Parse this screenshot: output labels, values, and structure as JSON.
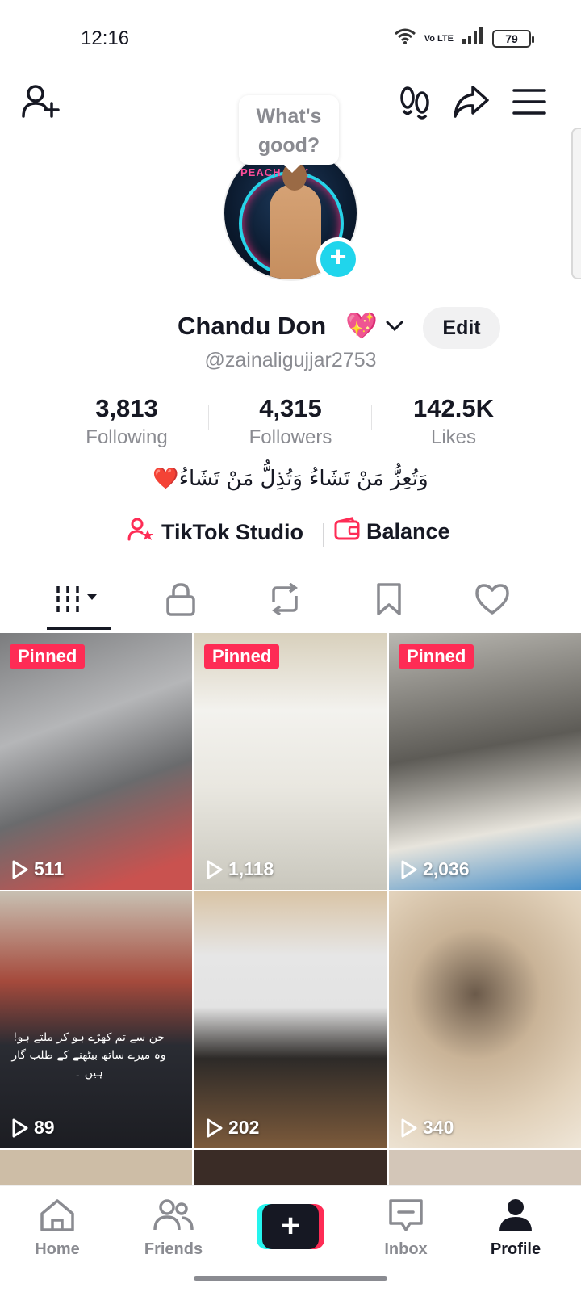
{
  "status_bar": {
    "time": "12:16",
    "network": "Vo LTE",
    "battery": "79"
  },
  "bubble": {
    "text": "What's good?"
  },
  "avatar": {
    "overlay_text": "PEACH TOK"
  },
  "profile": {
    "display_name": "Chandu Don",
    "name_emoji": "💖",
    "edit_label": "Edit",
    "username": "@zainaligujjar2753",
    "bio": "وَتُعِزُّ مَنْ تَشَاءُ وَتُذِلُّ مَنْ تَشَاءُ❤️"
  },
  "stats": [
    {
      "value": "3,813",
      "label": "Following"
    },
    {
      "value": "4,315",
      "label": "Followers"
    },
    {
      "value": "142.5K",
      "label": "Likes"
    }
  ],
  "links": {
    "studio": "TikTok Studio",
    "balance": "Balance"
  },
  "tabs": [
    "videos-tab",
    "private-tab",
    "reposts-tab",
    "favorites-tab",
    "liked-tab"
  ],
  "videos": [
    {
      "views": "511",
      "pinned": "Pinned"
    },
    {
      "views": "1,118",
      "pinned": "Pinned"
    },
    {
      "views": "2,036",
      "pinned": "Pinned"
    },
    {
      "views": "89",
      "overlay": "جن سے تم کھڑے ہو کر ملتے ہو! وہ میرے ساتھ بیٹھنے کے طلب گار ہیں ۔"
    },
    {
      "views": "202"
    },
    {
      "views": "340"
    }
  ],
  "bottom_nav": {
    "home": "Home",
    "friends": "Friends",
    "inbox": "Inbox",
    "profile": "Profile"
  },
  "colors": {
    "accent": "#fe2c55",
    "cyan": "#25f4ee",
    "text": "#161823",
    "muted": "#8a8b91"
  }
}
